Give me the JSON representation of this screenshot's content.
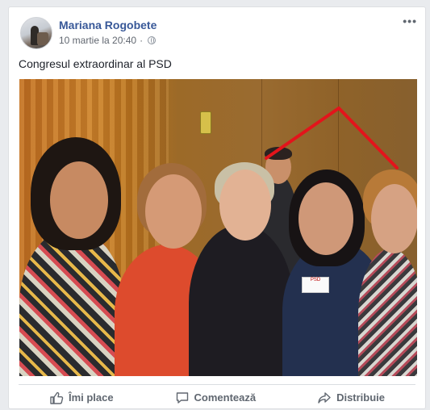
{
  "post": {
    "author": "Mariana Rogobete",
    "timestamp": "10 martie la 20:40",
    "separator": "·",
    "privacy_icon": "globe-icon",
    "more_label": "•••",
    "text": "Congresul extraordinar al PSD"
  },
  "photo": {
    "badge_text": "PSD",
    "annotation_color": "#e3141b"
  },
  "actions": {
    "like_label": "Îmi place",
    "comment_label": "Comentează",
    "share_label": "Distribuie"
  },
  "colors": {
    "author": "#385898",
    "meta": "#616770",
    "action": "#606770"
  }
}
